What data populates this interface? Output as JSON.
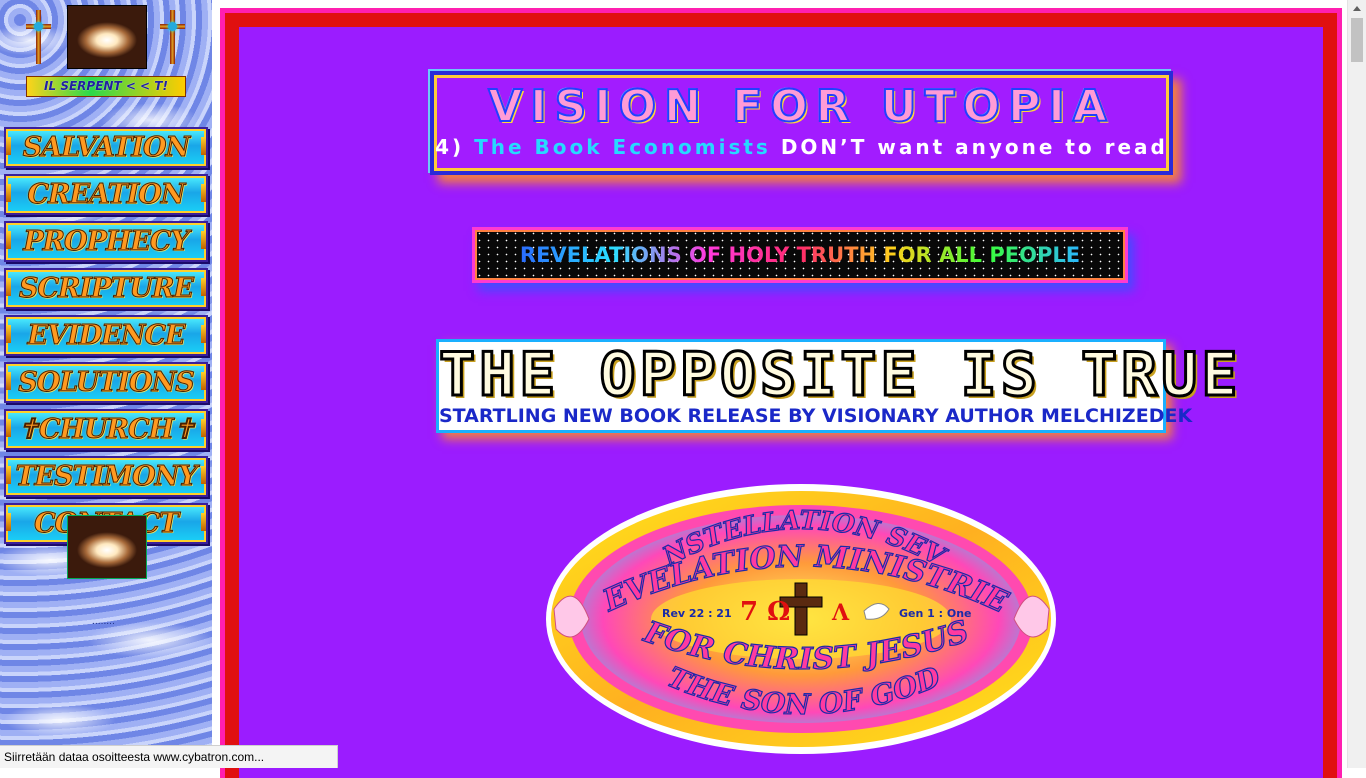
{
  "sidebar": {
    "serpent_banner": "IL SERPENT < < T!",
    "nav": [
      {
        "label": "SALVATION",
        "name": "nav-salvation"
      },
      {
        "label": "CREATION",
        "name": "nav-creation"
      },
      {
        "label": "PROPHECY",
        "name": "nav-prophecy"
      },
      {
        "label": "SCRIPTURE",
        "name": "nav-scripture"
      },
      {
        "label": "EVIDENCE",
        "name": "nav-evidence"
      },
      {
        "label": "SOLUTIONS",
        "name": "nav-solutions"
      },
      {
        "label": "✝CHURCH✝",
        "name": "nav-church"
      },
      {
        "label": "TESTIMONY",
        "name": "nav-testimony"
      },
      {
        "label": "CONTACT",
        "name": "nav-contact"
      }
    ],
    "dots": "........"
  },
  "main": {
    "vision": {
      "title": "VISION FOR UTOPIA",
      "sub_number": "4)",
      "sub_highlight": "The Book Economists",
      "sub_rest": "DON’T want anyone to read"
    },
    "revelations": "REVELATIONS OF HOLY TRUTH FOR ALL PEOPLE",
    "opposite": {
      "title": "THE OPPOSITE IS TRUE",
      "subtitle": "STARTLING NEW BOOK RELEASE BY VISIONARY AUTHOR MELCHIZEDEK"
    },
    "emblem": {
      "line1": "CONSTELLATION SEVEN",
      "line2": "REVELATION MINISTRIES",
      "left_ref": "Rev 22 : 21",
      "symbols": "7 Ω",
      "lambda": "Λ",
      "right_ref": "Gen 1 : One",
      "line3": "FOR CHRIST JESUS",
      "line4": "THE SON OF GOD"
    }
  },
  "status_bar": "Siirretään dataa osoitteesta www.cybatron.com...",
  "colors": {
    "content_bg": "#9b1cff",
    "frame_pink": "#ff1fb0",
    "frame_red": "#e01010"
  }
}
